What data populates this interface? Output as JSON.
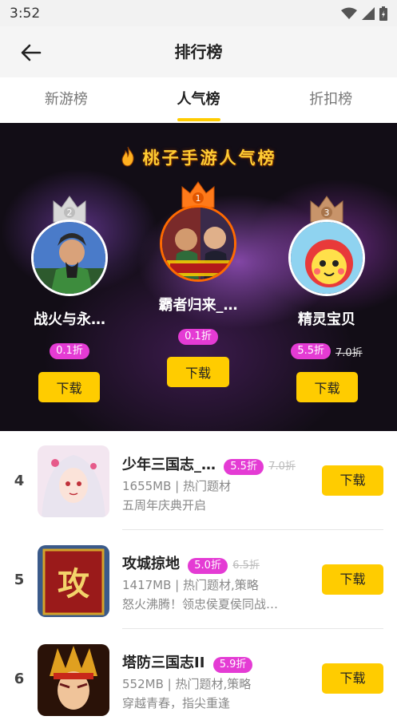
{
  "status_bar": {
    "time": "3:52",
    "icons": [
      "wifi-icon",
      "signal-icon",
      "battery-icon"
    ]
  },
  "app_bar": {
    "title": "排行榜",
    "back_icon": "arrow-left-icon"
  },
  "tabs": [
    {
      "label": "新游榜",
      "active": false
    },
    {
      "label": "人气榜",
      "active": true
    },
    {
      "label": "折扣榜",
      "active": false
    }
  ],
  "banner": {
    "title": "桃子手游人气榜",
    "top3": [
      {
        "rank": "2",
        "name": "战火与永…",
        "discount": "0.1折",
        "original_price": "",
        "button": "下载"
      },
      {
        "rank": "1",
        "name": "霸者归来_…",
        "discount": "0.1折",
        "original_price": "",
        "button": "下载"
      },
      {
        "rank": "3",
        "name": "精灵宝贝",
        "discount": "5.5折",
        "original_price": "7.0折",
        "button": "下载"
      }
    ]
  },
  "list": [
    {
      "rank": "4",
      "name": "少年三国志_…",
      "discount": "5.5折",
      "original_price": "7.0折",
      "meta": "1655MB | 热门题材",
      "desc": "五周年庆典开启",
      "button": "下载"
    },
    {
      "rank": "5",
      "name": "攻城掠地",
      "discount": "5.0折",
      "original_price": "6.5折",
      "meta": "1417MB | 热门题材,策略",
      "desc": "怒火沸腾！领忠侯夏侯同战…",
      "button": "下载"
    },
    {
      "rank": "6",
      "name": "塔防三国志II",
      "discount": "5.9折",
      "original_price": "",
      "meta": "552MB | 热门题材,策略",
      "desc": "穿越青春，指尖重逢",
      "button": "下载"
    }
  ],
  "colors": {
    "accent": "#ffcc00",
    "badge": "#e43bd4",
    "gold_ring": "#ff6a00"
  }
}
